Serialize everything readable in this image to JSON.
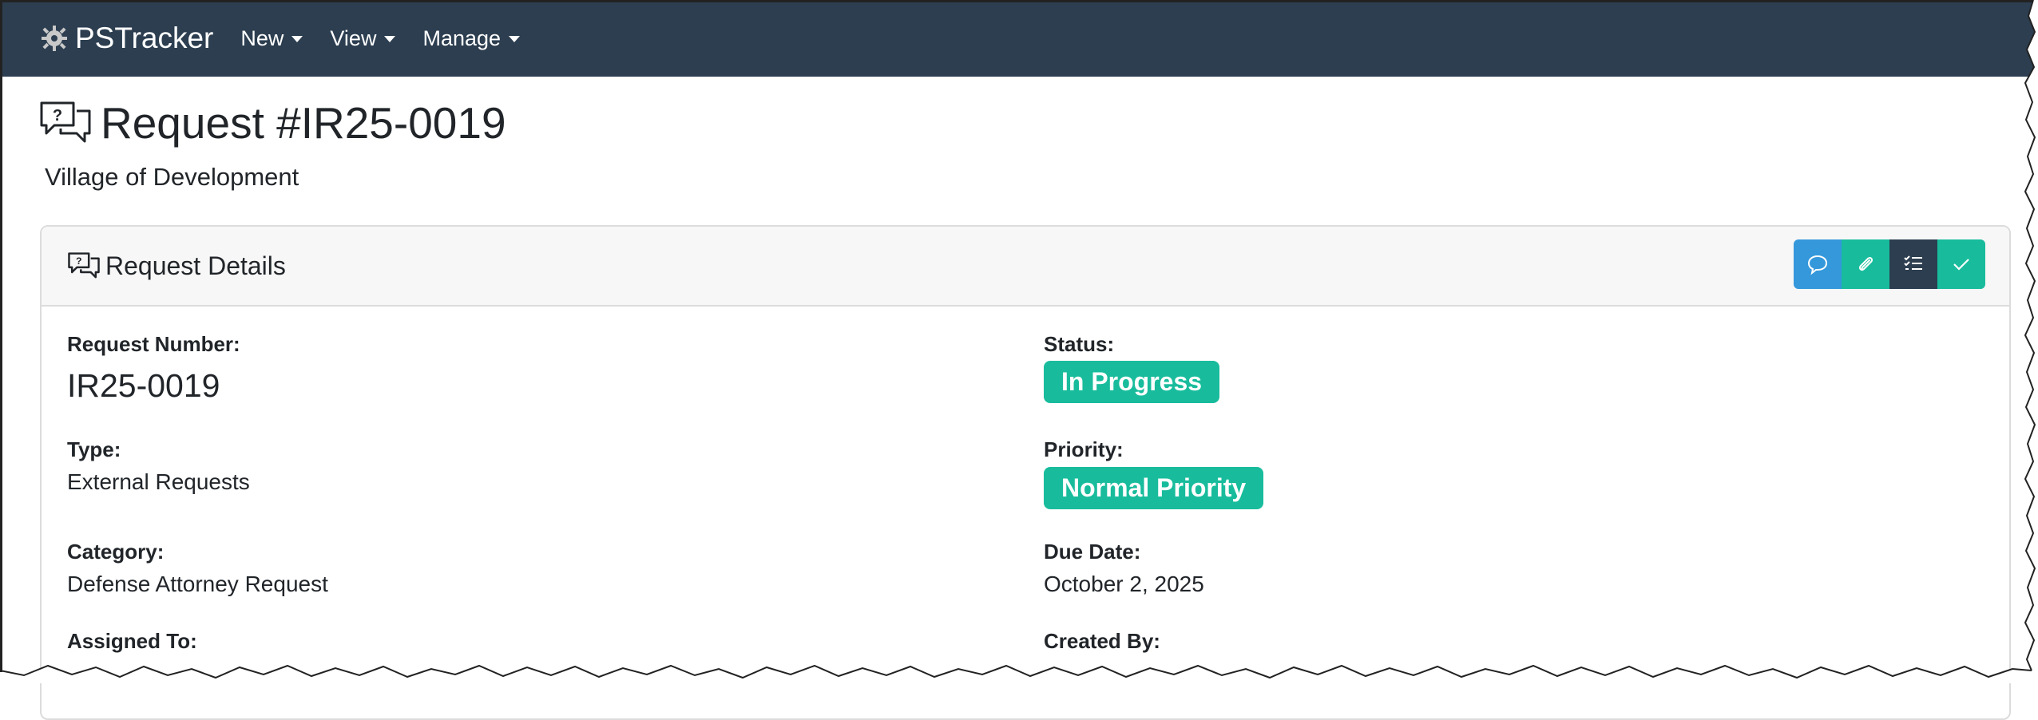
{
  "navbar": {
    "brand": "PSTracker",
    "menus": [
      {
        "label": "New"
      },
      {
        "label": "View"
      },
      {
        "label": "Manage"
      }
    ]
  },
  "page": {
    "title": "Request #IR25-0019",
    "subtitle": "Village of Development"
  },
  "card": {
    "title": "Request Details",
    "actions": [
      {
        "icon": "comment-icon",
        "color": "#3498db"
      },
      {
        "icon": "paperclip-icon",
        "color": "#18bc9c"
      },
      {
        "icon": "checklist-icon",
        "color": "#2c3e50"
      },
      {
        "icon": "check-icon",
        "color": "#18bc9c"
      }
    ]
  },
  "fields": {
    "request_number": {
      "label": "Request Number:",
      "value": "IR25-0019"
    },
    "type": {
      "label": "Type:",
      "value": "External Requests"
    },
    "category": {
      "label": "Category:",
      "value": "Defense Attorney Request"
    },
    "assigned_to": {
      "label": "Assigned To:"
    },
    "status": {
      "label": "Status:",
      "value": "In Progress"
    },
    "priority": {
      "label": "Priority:",
      "value": "Normal Priority"
    },
    "due_date": {
      "label": "Due Date:",
      "value": "October 2, 2025"
    },
    "created_by": {
      "label": "Created By:"
    }
  },
  "colors": {
    "navbar": "#2c3e50",
    "primary": "#3498db",
    "success": "#18bc9c",
    "dark": "#2c3e50"
  }
}
